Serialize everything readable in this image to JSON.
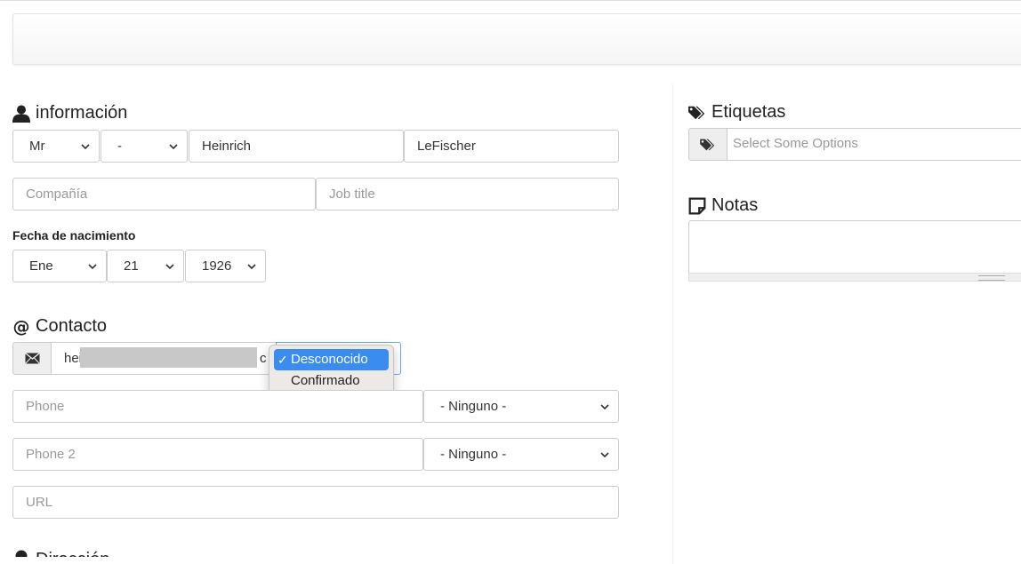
{
  "sections": {
    "informacion": "información",
    "contacto": "Contacto",
    "etiquetas": "Etiquetas",
    "notas": "Notas",
    "direccion_partial": "Dirección"
  },
  "info": {
    "salutation": "Mr",
    "suffix": "-",
    "first_name": "Heinrich",
    "last_name": "LeFischer",
    "company_placeholder": "Compañía",
    "job_title_placeholder": "Job title"
  },
  "birthdate": {
    "label": "Fecha de nacimiento",
    "month": "Ene",
    "day": "21",
    "year": "1926"
  },
  "contact": {
    "email_prefix": "hei",
    "email_suffix": "c",
    "status_options": [
      "Desconocido",
      "Confirmado"
    ],
    "status_selected_check": "✓",
    "phone_placeholder": "Phone",
    "phone_type": "- Ninguno -",
    "phone2_placeholder": "Phone 2",
    "phone2_type": "- Ninguno -",
    "url_placeholder": "URL"
  },
  "tags": {
    "placeholder": "Select Some Options"
  },
  "icons": {
    "person": "person-icon",
    "at": "at-icon",
    "envelope": "envelope-icon",
    "tags": "tags-icon",
    "tag": "tag-icon",
    "note": "note-icon",
    "chevron": "chevron-down-icon"
  }
}
